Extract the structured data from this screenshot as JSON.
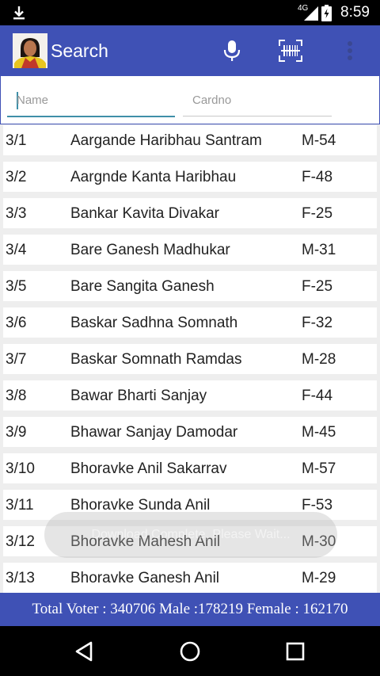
{
  "status_bar": {
    "network": "4G",
    "time": "8:59"
  },
  "app_bar": {
    "title": "Search"
  },
  "search": {
    "name_placeholder": "Name",
    "cardno_placeholder": "Cardno"
  },
  "rows": [
    {
      "no": "3/1",
      "name": "Aargande Haribhau Santram",
      "gender_age": "M-54"
    },
    {
      "no": "3/2",
      "name": "Aargnde Kanta Haribhau",
      "gender_age": "F-48"
    },
    {
      "no": "3/3",
      "name": "Bankar Kavita Divakar",
      "gender_age": "F-25"
    },
    {
      "no": "3/4",
      "name": "Bare Ganesh Madhukar",
      "gender_age": "M-31"
    },
    {
      "no": "3/5",
      "name": "Bare Sangita Ganesh",
      "gender_age": "F-25"
    },
    {
      "no": "3/6",
      "name": "Baskar Sadhna Somnath",
      "gender_age": "F-32"
    },
    {
      "no": "3/7",
      "name": "Baskar Somnath Ramdas",
      "gender_age": "M-28"
    },
    {
      "no": "3/8",
      "name": "Bawar Bharti Sanjay",
      "gender_age": "F-44"
    },
    {
      "no": "3/9",
      "name": "Bhawar Sanjay Damodar",
      "gender_age": "M-45"
    },
    {
      "no": "3/10",
      "name": "Bhoravke Anil Sakarrav",
      "gender_age": "M-57"
    },
    {
      "no": "3/11",
      "name": "Bhoravke Sunda Anil",
      "gender_age": "F-53"
    },
    {
      "no": "3/12",
      "name": "Bhoravke Mahesh Anil",
      "gender_age": "M-30"
    },
    {
      "no": "3/13",
      "name": "Bhoravke Ganesh Anil",
      "gender_age": "M-29"
    }
  ],
  "toast": {
    "text": "Download Complete, Please Wait..."
  },
  "footer": {
    "summary": "Total Voter : 340706 Male :178219 Female : 162170"
  },
  "colors": {
    "primary": "#3f51b5",
    "accent": "#3f8fa8"
  },
  "icons": [
    "download-icon",
    "signal-icon",
    "battery-icon",
    "mic-icon",
    "barcode-icon",
    "more-vert-icon",
    "back-icon",
    "home-icon",
    "recents-icon"
  ]
}
